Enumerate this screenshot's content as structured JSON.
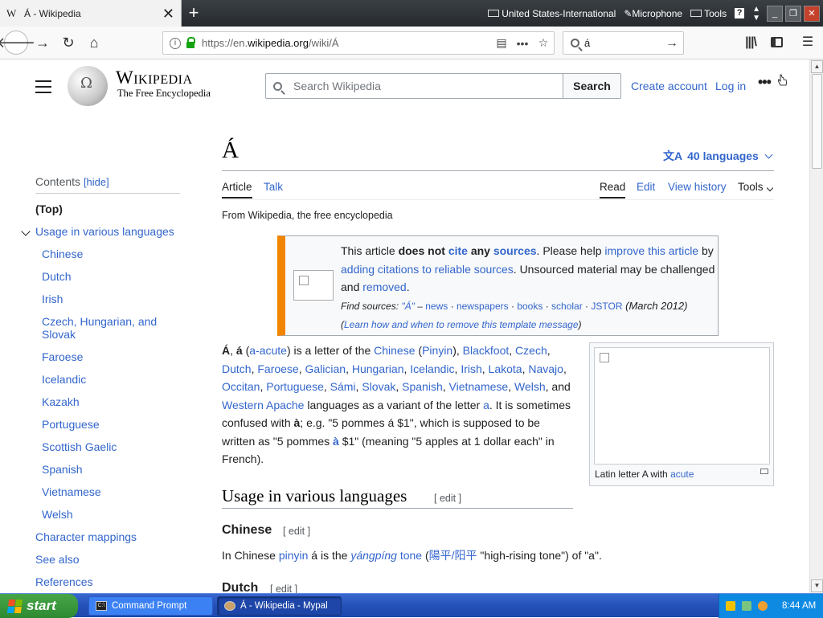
{
  "browser": {
    "tab_favicon": "W",
    "tab_title": "Á - Wikipedia",
    "tab_close": "✕",
    "new_tab": "+",
    "system": {
      "keyboard": "United States-International",
      "microphone": "Microphone",
      "tools": "Tools",
      "help": "?"
    },
    "url_prefix": "https://en.",
    "url_domain": "wikipedia.org",
    "url_path": "/wiki/Á",
    "search_value": "á"
  },
  "wiki": {
    "wordmark": "Wikipedia",
    "tagline": "The Free Encyclopedia",
    "search_placeholder": "Search Wikipedia",
    "search_button": "Search",
    "create_account": "Create account",
    "log_in": "Log in",
    "more": "•••"
  },
  "toc": {
    "title": "Contents",
    "hide": "[hide]",
    "top": "(Top)",
    "section": "Usage in various languages",
    "items": [
      "Chinese",
      "Dutch",
      "Irish",
      "Czech, Hungarian, and Slovak",
      "Faroese",
      "Icelandic",
      "Kazakh",
      "Portuguese",
      "Scottish Gaelic",
      "Spanish",
      "Vietnamese",
      "Welsh"
    ],
    "after": [
      "Character mappings",
      "See also",
      "References"
    ]
  },
  "article": {
    "title": "Á",
    "languages": "40 languages",
    "tabs": {
      "article": "Article",
      "talk": "Talk",
      "read": "Read",
      "edit": "Edit",
      "history": "View history",
      "tools": "Tools"
    },
    "from": "From Wikipedia, the free encyclopedia",
    "notice": {
      "t1": "This article ",
      "t2": "does not ",
      "t3": "cite",
      "t4": " any ",
      "t5": "sources",
      "t6": ". Please help ",
      "t7": "improve this article",
      "t8": " by ",
      "t9": "adding citations to reliable sources",
      "t10": ". Unsourced material may be challenged and ",
      "t11": "removed",
      "t12": ".",
      "find": "Find sources: ",
      "q": "\"Á\"",
      "dash": " – ",
      "news": "news",
      "newspapers": "newspapers",
      "books": "books",
      "scholar": "scholar",
      "jstor": "JSTOR",
      "date": " (March 2012)",
      "learn": "Learn how and when to remove this template message"
    },
    "intro": {
      "a": "Á",
      "b": "á",
      "c": "a-acute",
      "d": " is a letter of the ",
      "langs": [
        "Chinese",
        "Pinyin",
        "Blackfoot",
        "Czech",
        "Dutch",
        "Faroese",
        "Galician",
        "Hungarian",
        "Icelandic",
        "Irish",
        "Lakota",
        "Navajo",
        "Occitan",
        "Portuguese",
        "Sámi",
        "Slovak",
        "Spanish",
        "Vietnamese",
        "Welsh"
      ],
      "and": "and ",
      "western": "Western Apache",
      "e": " languages as a variant of the letter ",
      "aa": "a",
      "f": ". It is sometimes confused with ",
      "agr": "à",
      "g": "; e.g. \"5 pommes á $1\", which is supposed to be written as \"5 pommes ",
      "h": " $1\" (meaning \"5 apples at 1 dollar each\" in French)."
    },
    "infobox_caption": "Latin letter A with ",
    "infobox_link": "acute",
    "h2": "Usage in various languages",
    "edit": "[ edit ]",
    "h3_chinese": "Chinese",
    "chinese_text": {
      "a": "In Chinese ",
      "pinyin": "pinyin",
      "b": " á is the ",
      "yang": "yángpíng",
      "tone": "tone",
      "han": "陽平/阳平",
      "c": " \"high-rising tone\") of \"a\"."
    },
    "h3_dutch": "Dutch"
  },
  "taskbar": {
    "start": "start",
    "task1": "Command Prompt",
    "task2": "Á - Wikipedia - Mypal",
    "clock": "8:44 AM"
  }
}
